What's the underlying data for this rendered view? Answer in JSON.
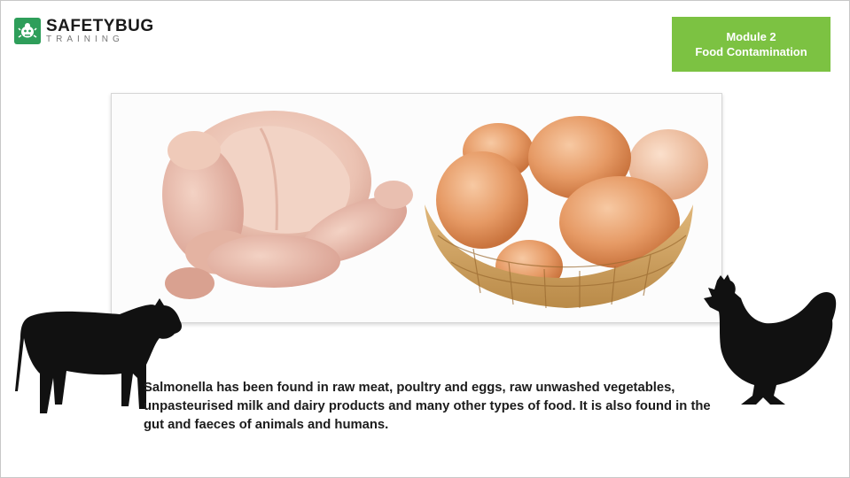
{
  "brand": {
    "name": "SAFETYBUG",
    "tagline": "TRAINING",
    "icon": "bug-logo-icon",
    "color": "#2e9e5a"
  },
  "module": {
    "number_label": "Module 2",
    "title": "Food Contamination",
    "color": "#7cc242"
  },
  "images": {
    "left": "raw-chicken",
    "right": "eggs-in-basket",
    "left_silhouette": "cow-silhouette-icon",
    "right_silhouette": "hen-silhouette-icon"
  },
  "content": {
    "paragraph": "Salmonella has been found in raw meat, poultry and eggs, raw unwashed vegetables, unpasteurised milk and dairy products and many other types of food. It is also found in the gut and faeces of animals and humans."
  }
}
